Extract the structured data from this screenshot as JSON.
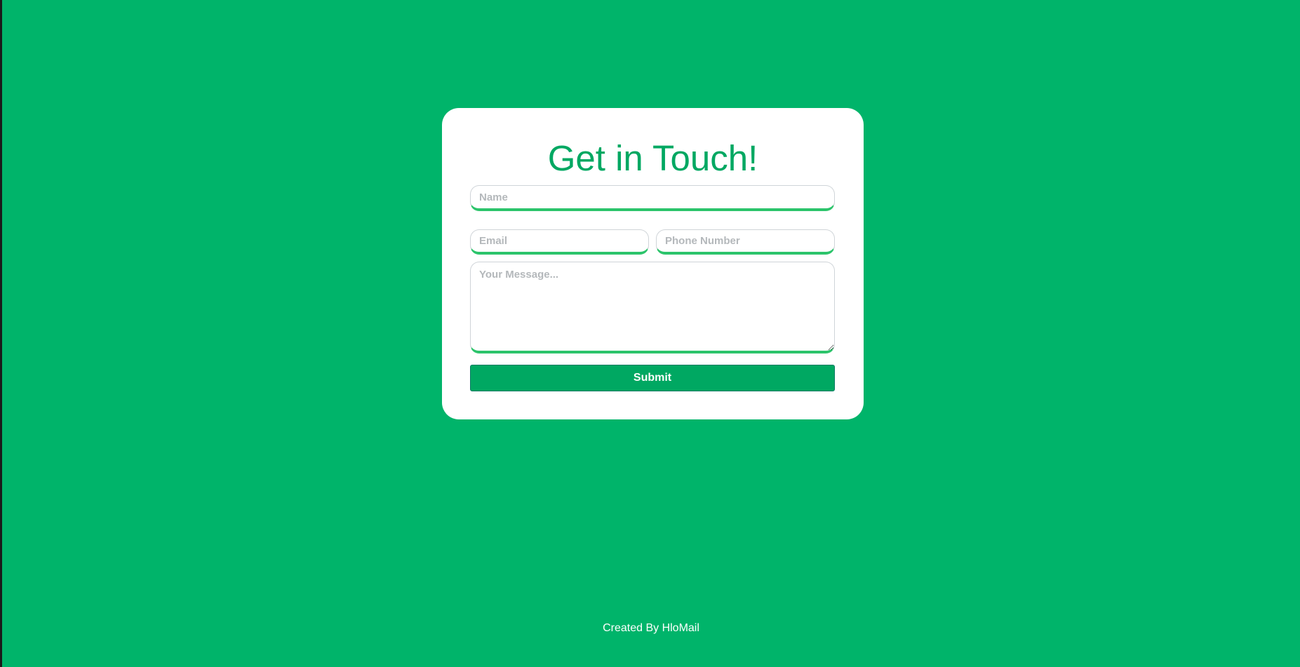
{
  "form": {
    "title": "Get in Touch!",
    "name_placeholder": "Name",
    "email_placeholder": "Email",
    "phone_placeholder": "Phone Number",
    "message_placeholder": "Your Message...",
    "submit_label": "Submit"
  },
  "footer": {
    "credit": "Created By HloMail"
  },
  "colors": {
    "background": "#00b46a",
    "accent": "#00a862",
    "field_underline": "#2cc46b",
    "card": "#ffffff"
  }
}
